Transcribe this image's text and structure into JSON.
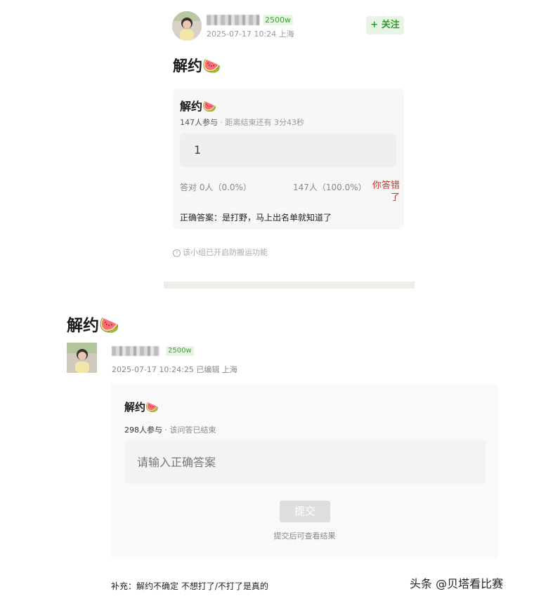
{
  "top_post": {
    "follower_badge": "2500w",
    "meta": "2025-07-17 10:24  上海",
    "follow_label": "+ 关注",
    "title": "解约🍉",
    "poll": {
      "title": "解约🍉",
      "participants": "147人参与",
      "countdown": " · 距离结束还有 3分43秒",
      "user_answer": "1",
      "correct_stat": "答对  0人（0.0%）",
      "wrong_stat": "147人（100.0%）",
      "wrong_label": "你答错了",
      "correct_answer": "正确答案：是打野，马上出名单就知道了"
    },
    "notice_icon": "?",
    "notice": "该小组已开启防搬运功能"
  },
  "bottom_post": {
    "title": "解约🍉",
    "follower_badge": "2500w",
    "meta": "2025-07-17 10:24:25 已编辑 上海",
    "poll": {
      "title": "解约🍉",
      "participants": "298人参与",
      "status": " · 该问答已结束",
      "input_placeholder": "请输入正确答案",
      "submit_label": "提交",
      "submit_hint": "提交后可查看结果"
    },
    "supplement": "补充：解约不确定 不想打了/不打了是真的"
  },
  "watermark": "头条 @贝塔看比赛",
  "colors": {
    "accent_green": "#2f9b2f",
    "wrong_red": "#c0392b"
  }
}
